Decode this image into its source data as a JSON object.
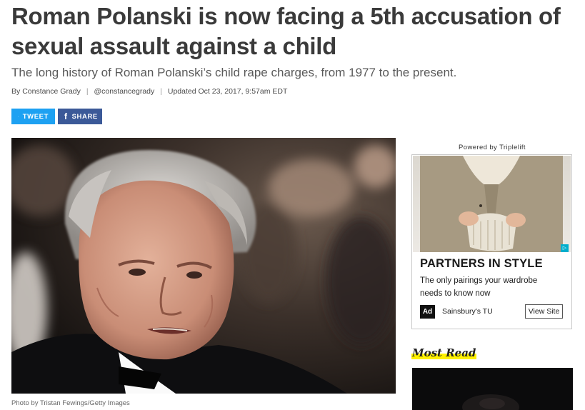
{
  "article": {
    "headline": "Roman Polanski is now facing a 5th accusation of sexual assault against a child",
    "dek": "The long history of Roman Polanski’s child rape charges, from 1977 to the present.",
    "byline_prefix": "By",
    "author": "Constance Grady",
    "separator": "|",
    "handle": "@constancegrady",
    "updated": "Updated Oct 23, 2017, 9:57am EDT",
    "photo_caption": "Photo by Tristan Fewings/Getty Images"
  },
  "share": {
    "tweet_label": "TWEET",
    "share_label": "SHARE",
    "twitter_icon": "twitter-bird-icon",
    "facebook_icon": "facebook-f-icon",
    "twitter_color": "#1da1f2",
    "facebook_color": "#3b5998"
  },
  "ad": {
    "powered_by": "Powered by Triplelift",
    "title": "PARTNERS IN STYLE",
    "body": "The only pairings your wardrobe needs to know now",
    "badge": "Ad",
    "sponsor": "Sainsbury's TU",
    "cta": "View Site",
    "adchoices_icon": "adchoices-icon"
  },
  "sidebar": {
    "most_read_label": "Most Read",
    "highlight_color": "#fff200"
  }
}
